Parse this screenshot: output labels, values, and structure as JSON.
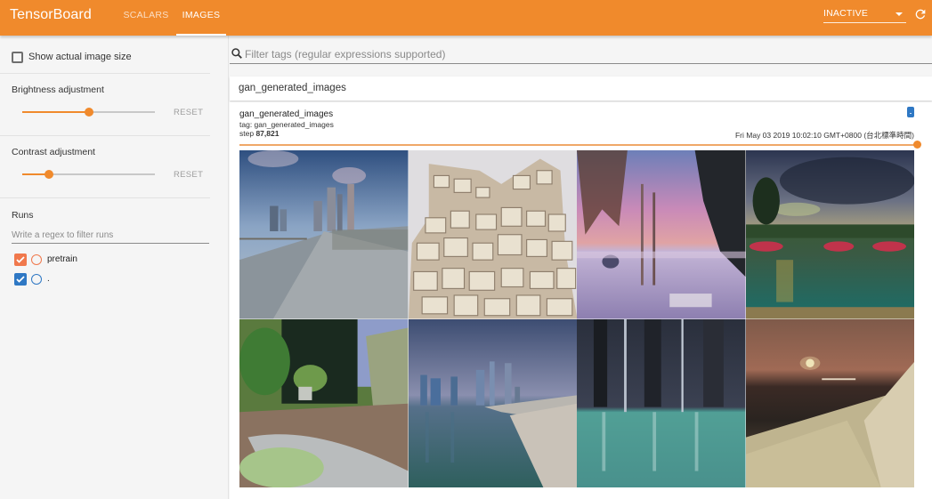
{
  "header": {
    "brand": "TensorBoard",
    "tabs": [
      {
        "label": "SCALARS",
        "active": false
      },
      {
        "label": "IMAGES",
        "active": true
      }
    ],
    "status_select": "INACTIVE",
    "refresh_icon": "refresh-icon",
    "accent_color": "#f08a2c"
  },
  "sidebar": {
    "show_actual_size": {
      "label": "Show actual image size",
      "checked": false
    },
    "brightness": {
      "title": "Brightness adjustment",
      "value_fraction": 0.5,
      "reset": "RESET"
    },
    "contrast": {
      "title": "Contrast adjustment",
      "value_fraction": 0.2,
      "reset": "RESET"
    },
    "runs": {
      "title": "Runs",
      "filter_placeholder": "Write a regex to filter runs",
      "items": [
        {
          "label": "pretrain",
          "checked": true,
          "color": "#f0784c"
        },
        {
          "label": ".",
          "checked": true,
          "color": "#2f78c4"
        }
      ]
    }
  },
  "main": {
    "filter_placeholder": "Filter tags (regular expressions supported)",
    "tag_group": "gan_generated_images",
    "card": {
      "title": "gan_generated_images",
      "tag_line": "tag: gan_generated_images",
      "step_label": "step",
      "step_value": "87,821",
      "timestamp": "Fri May 03 2019 10:02:10 GMT+0800 (台北標準時間)",
      "step_fraction": 1.0,
      "images": [
        {
          "name": "city-bridge-walkway"
        },
        {
          "name": "stone-tower-ruin"
        },
        {
          "name": "pink-sunset-trees-beach"
        },
        {
          "name": "stormy-lake-green"
        },
        {
          "name": "forest-stream"
        },
        {
          "name": "city-skyline-water"
        },
        {
          "name": "dark-forest-reflection"
        },
        {
          "name": "sunset-dune-road"
        }
      ]
    }
  }
}
